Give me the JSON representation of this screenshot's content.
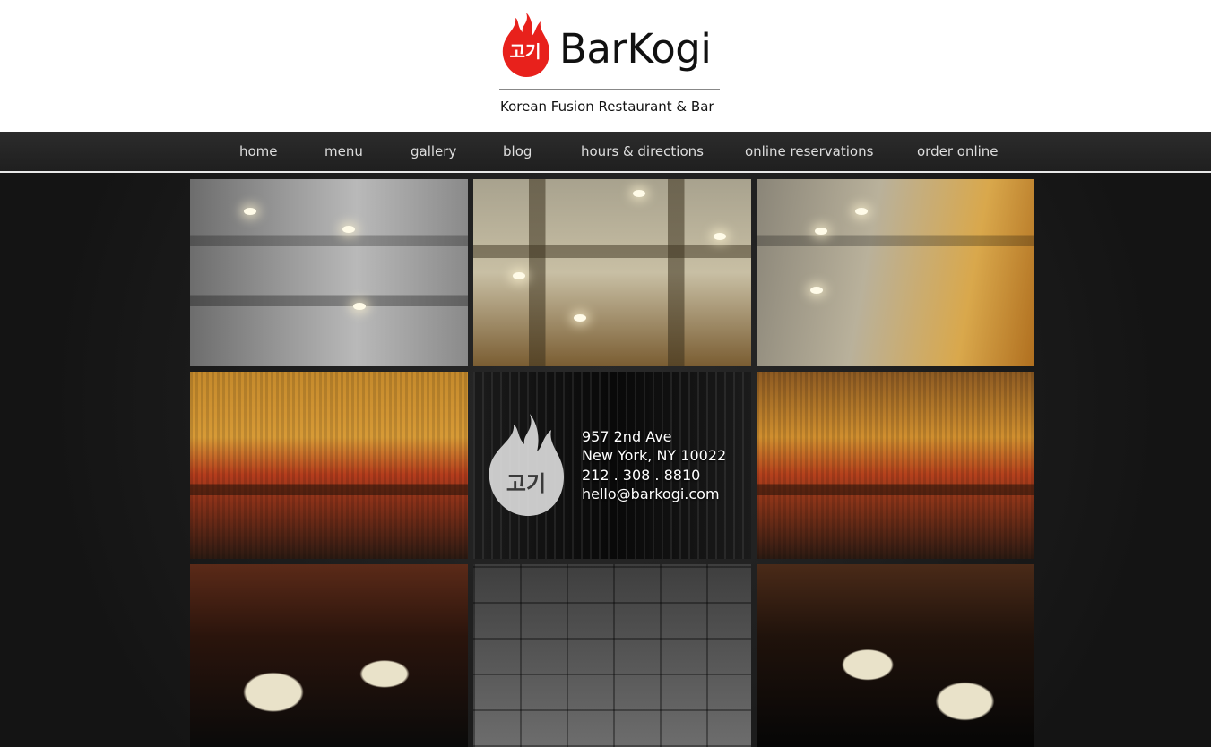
{
  "logo": {
    "flame_text": "고기",
    "name": "BarKogi",
    "tagline": "Korean Fusion Restaurant & Bar"
  },
  "nav": {
    "items": [
      {
        "label": "home"
      },
      {
        "label": "menu"
      },
      {
        "label": "gallery"
      },
      {
        "label": "blog"
      },
      {
        "label": "hours & directions"
      },
      {
        "label": "online reservations"
      },
      {
        "label": "order online"
      }
    ]
  },
  "info": {
    "flame_text": "고기",
    "address_line1": "957 2nd Ave",
    "address_line2": "New York, NY 10022",
    "phone": "212 . 308 . 8810",
    "email": "hello@barkogi.com"
  },
  "colors": {
    "brand_red": "#e8211c",
    "nav_bg": "#262626",
    "nav_text": "#dddddd"
  }
}
